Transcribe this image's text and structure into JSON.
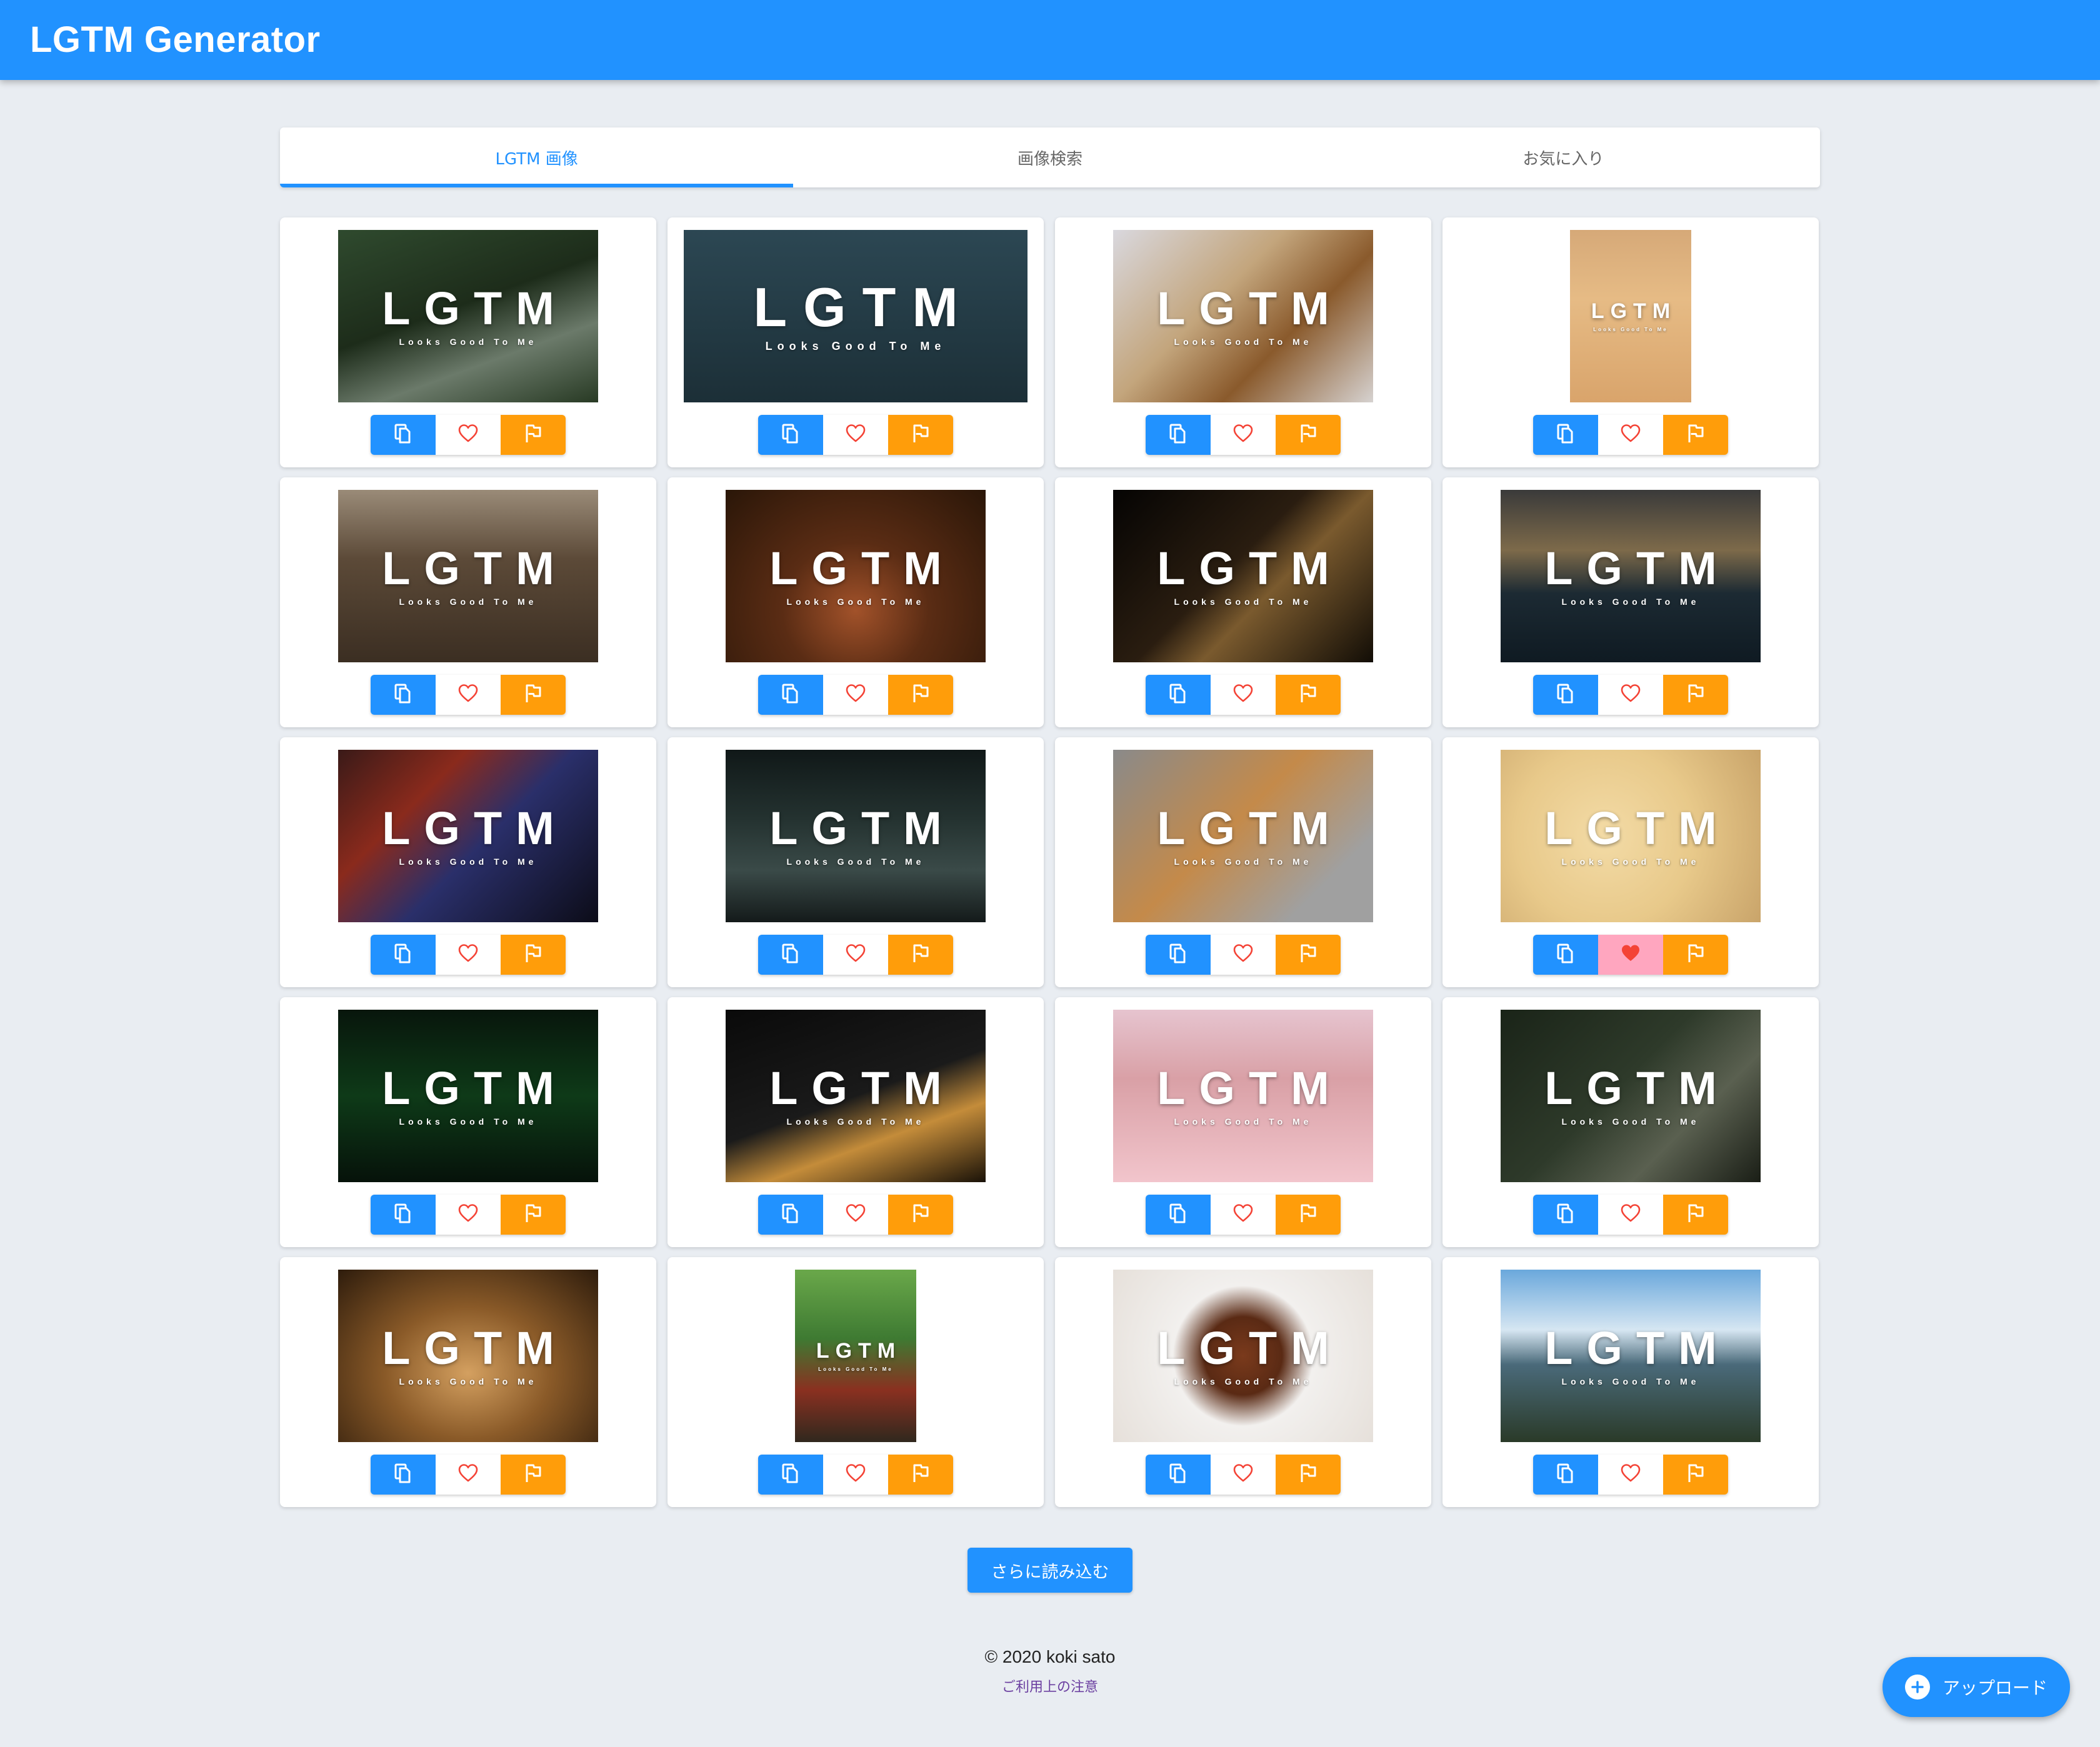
{
  "app": {
    "title": "LGTM Generator"
  },
  "tabs": [
    {
      "label": "LGTM 画像",
      "active": true
    },
    {
      "label": "画像検索",
      "active": false
    },
    {
      "label": "お気に入り",
      "active": false
    }
  ],
  "overlay": {
    "big": "LGTM",
    "small": "Looks Good To Me"
  },
  "cards": [
    {
      "subject": "forest-path",
      "bg": "linear-gradient(160deg,#2f4a2e 0%,#1d2c1a 45%,#6b7a6a 70%,#283a24 100%)",
      "shape": "normal",
      "favorite": false
    },
    {
      "subject": "ship-at-sea",
      "bg": "linear-gradient(180deg,#2c4753 0%,#233a44 55%,#1c2f37 100%)",
      "shape": "wide",
      "favorite": false
    },
    {
      "subject": "shiba-dog",
      "bg": "linear-gradient(135deg,#d9d8de 0%,#c3a57c 40%,#8a5a2c 65%,#d6d2d0 100%)",
      "shape": "normal",
      "favorite": false
    },
    {
      "subject": "guitar-body",
      "bg": "linear-gradient(180deg,#d6a978 0%,#e6bb85 40%,#d9a46b 100%)",
      "shape": "narrow",
      "favorite": false
    },
    {
      "subject": "kitten-in-blanket",
      "bg": "linear-gradient(180deg,#9a8b78 0%,#5c4a38 40%,#3b2e22 100%)",
      "shape": "normal",
      "favorite": false
    },
    {
      "subject": "birthday-cake",
      "bg": "radial-gradient(ellipse at 50% 70%,#a2522a 0%,#5a2c14 40%,#2a1608 100%)",
      "shape": "normal",
      "favorite": false
    },
    {
      "subject": "dog-in-dark",
      "bg": "linear-gradient(135deg,#050403 0%,#2a1d10 45%,#7a5a2e 60%,#120d06 100%)",
      "shape": "normal",
      "favorite": false
    },
    {
      "subject": "sunset-harbor",
      "bg": "linear-gradient(180deg,#3a3a3a 0%,#7d6a4a 35%,#1c2a33 60%,#0f1a22 100%)",
      "shape": "normal",
      "favorite": false
    },
    {
      "subject": "carnival-lights",
      "bg": "linear-gradient(135deg,#3a1a18 0%,#8a2a1c 30%,#2a2f6a 55%,#0c0c18 100%)",
      "shape": "normal",
      "favorite": false
    },
    {
      "subject": "dark-stadium",
      "bg": "linear-gradient(180deg,#101818 0%,#243230 40%,#3a4a48 70%,#141a1a 100%)",
      "shape": "normal",
      "favorite": false
    },
    {
      "subject": "shiba-close",
      "bg": "linear-gradient(135deg,#8a8a8a 0%,#c48a4a 45%,#a0a0a0 80%)",
      "shape": "normal",
      "favorite": false
    },
    {
      "subject": "chicks",
      "bg": "radial-gradient(circle at 40% 50%,#f3dba6 0%,#e8c98a 50%,#c9a46a 100%)",
      "shape": "normal",
      "favorite": true
    },
    {
      "subject": "binary-code",
      "bg": "linear-gradient(180deg,#08160c 0%,#0e3a18 50%,#06120a 100%)",
      "shape": "normal",
      "favorite": false
    },
    {
      "subject": "guitar-headstock",
      "bg": "linear-gradient(160deg,#0a0a0a 0%,#1a1a1a 50%,#c48c3a 70%,#1a1208 100%)",
      "shape": "normal",
      "favorite": false
    },
    {
      "subject": "cat-on-bed",
      "bg": "linear-gradient(180deg,#e6c4cf 0%,#d9a0a6 40%,#f2c5cc 100%)",
      "shape": "normal",
      "favorite": false
    },
    {
      "subject": "lion-statue",
      "bg": "linear-gradient(135deg,#1a2418 0%,#2e3a2a 45%,#5a6050 70%,#1a1e16 100%)",
      "shape": "normal",
      "favorite": false
    },
    {
      "subject": "chicks-warm",
      "bg": "radial-gradient(ellipse at 50% 60%,#d4a060 0%,#8a5a28 45%,#2e1c0c 100%)",
      "shape": "normal",
      "favorite": false
    },
    {
      "subject": "shrine-stairs",
      "bg": "linear-gradient(180deg,#6aa84a 0%,#3e7a32 40%,#8a3020 70%,#30281e 100%)",
      "shape": "narrow",
      "favorite": false
    },
    {
      "subject": "donut",
      "bg": "radial-gradient(circle at 50% 50%,#7a3a1c 0%,#5a2a14 25%,#f2f0ee 45%,#e6e0da 100%)",
      "shape": "normal",
      "favorite": false
    },
    {
      "subject": "coastal-view",
      "bg": "linear-gradient(180deg,#6aa8dc 0%,#d6e6f2 35%,#4a6a7a 55%,#2a3a28 100%)",
      "shape": "normal",
      "favorite": false
    }
  ],
  "load_more": "さらに読み込む",
  "footer": {
    "copyright": "© 2020 koki sato",
    "notice": "ご利用上の注意"
  },
  "fab": {
    "label": "アップロード"
  },
  "colors": {
    "primary": "#2192ff",
    "flag": "#ff9d0a",
    "favorite_on": "#ffa6bf",
    "heart": "#f44336"
  }
}
